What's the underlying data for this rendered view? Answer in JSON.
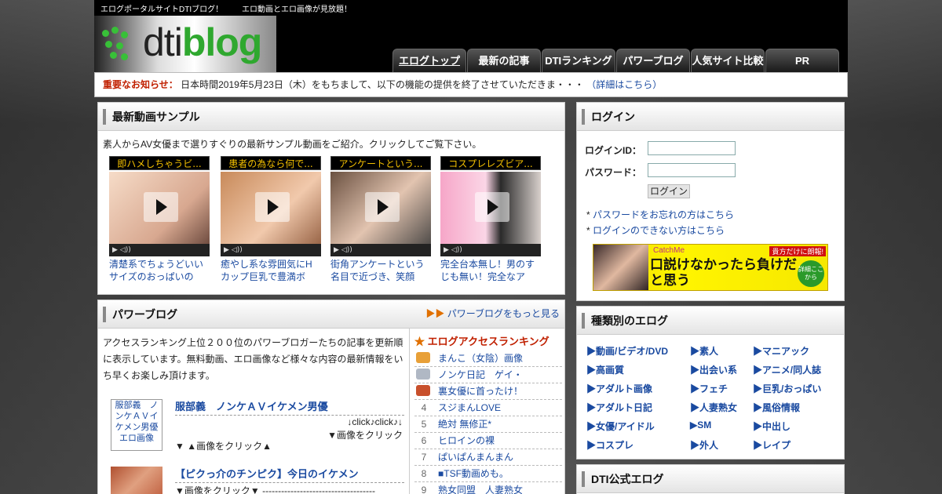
{
  "header": {
    "tagline1": "エログポータルサイトDTIブログ！",
    "tagline2": "エロ動画とエロ画像が見放題！",
    "logo_text_a": "dti",
    "logo_text_b": "blog"
  },
  "nav": {
    "tabs": [
      "エログトップ",
      "最新の記事",
      "DTIランキング",
      "パワーブログ",
      "人気サイト比較",
      "PR"
    ]
  },
  "notice": {
    "label": "重要なお知らせ：",
    "text": "日本時間2019年5月23日（木）をもちまして、以下の機能の提供を終了させていただきま・・・",
    "link": "（詳細はこちら）"
  },
  "videos": {
    "title": "最新動画サンプル",
    "intro": "素人からAV女優まで選りすぐりの最新サンプル動画をご紹介。クリックしてご覧下さい。",
    "items": [
      {
        "title": "即ハメしちゃうビ...",
        "desc": "清楚系でちょうどいいサイズのおっぱいの小..."
      },
      {
        "title": "患者の為なら何で...",
        "desc": "癒やし系な雰囲気にHカップ巨乳で豊満ボデ..."
      },
      {
        "title": "アンケートという...",
        "desc": "街角アンケートという名目で近づき、笑顔が..."
      },
      {
        "title": "コスプレレズビア...",
        "desc": "完全台本無し！男のすじも無い！完全なアド..."
      }
    ]
  },
  "powerblog": {
    "title": "パワーブログ",
    "more": "パワーブログをもっと見る",
    "intro": "アクセスランキング上位２００位のパワーブロガーたちの記事を更新順に表示しています。無料動画、エロ画像など様々な内容の最新情報をいち早くお楽しみ頂けます。",
    "entries": [
      {
        "img_alt": "服部義　ノンケＡＶイケメン男優 エロ画像",
        "title": "服部義　ノンケＡＶイケメン男優",
        "line1": "↓click♪click♪↓",
        "line2": "▼画像をクリック",
        "line3": "▼ ▲画像をクリック▲"
      },
      {
        "title": "【ピクっ介のチンピク】今日のイケメン",
        "line1": "▼画像をクリック▼ ------------------------------------"
      }
    ]
  },
  "ranking": {
    "title": "エログアクセスランキング",
    "items": [
      "まんこ（女陰）画像",
      "ノンケ日記　ゲイ・",
      "裏女優に首ったけ！",
      "スジまんLOVE",
      "絶対 無修正*",
      "ヒロインの裸",
      "ぱいぱんまんまん",
      "■TSF動画めも。",
      "熟女同盟　人妻熟女"
    ],
    "numbers": [
      "1",
      "2",
      "3",
      "4",
      "5",
      "6",
      "7",
      "8",
      "9"
    ]
  },
  "login": {
    "title": "ログイン",
    "id_label": "ログインID：",
    "pw_label": "パスワード：",
    "button": "ログイン",
    "forgot": "パスワードをお忘れの方はこちら",
    "cannot": "ログインのできない方はこちら",
    "banner_top": "貴方だけに朗報!",
    "banner_brand": "CatchMe",
    "banner_main": "口説けなかったら負けだと思う",
    "banner_btn": "詳細ここから"
  },
  "categories": {
    "title": "種類別のエログ",
    "items": [
      "動画/ビデオ/DVD",
      "素人",
      "マニアック",
      "高画質",
      "出会い系",
      "アニメ/同人誌",
      "アダルト画像",
      "フェチ",
      "巨乳/おっぱい",
      "アダルト日記",
      "人妻熟女",
      "風俗情報",
      "女優/アイドル",
      "SM",
      "中出し",
      "コスプレ",
      "外人",
      "レイプ"
    ]
  },
  "official": {
    "title": "DTI公式エログ"
  },
  "colors": {
    "accent_green": "#2fa82f",
    "link_blue": "#1a4aa0",
    "notice_red": "#c02000",
    "ranking_red": "#c02000"
  }
}
